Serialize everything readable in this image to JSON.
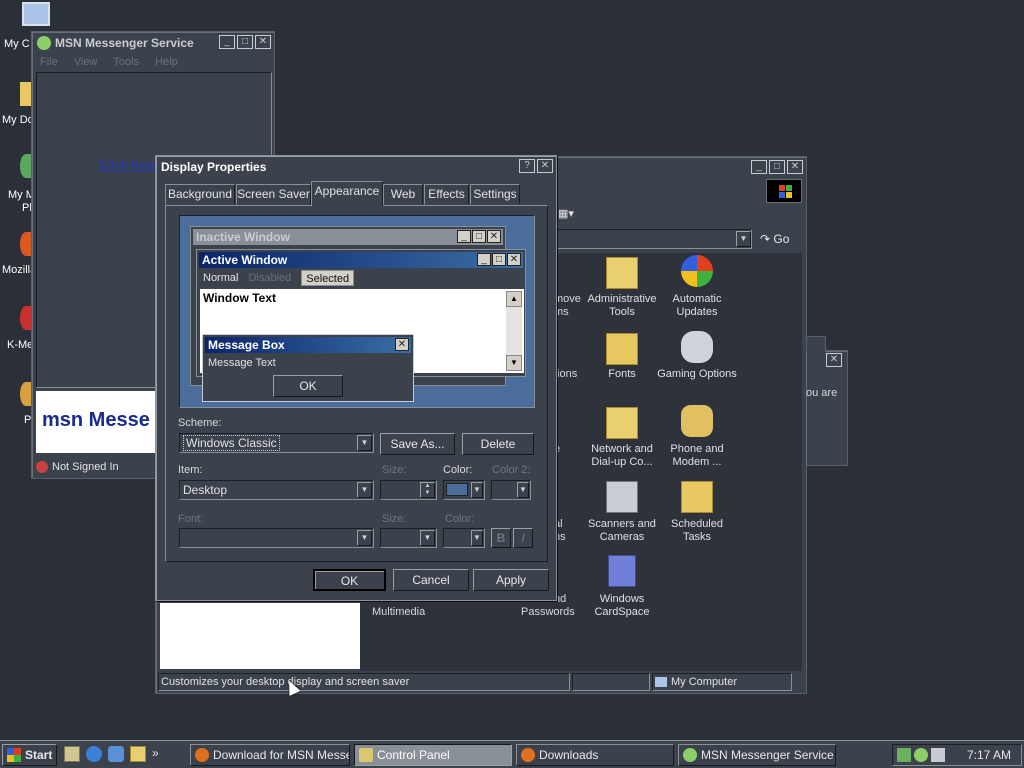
{
  "desktop": {
    "icons": [
      {
        "label": "My C"
      },
      {
        "label": "My Do"
      },
      {
        "label": "My M"
      },
      {
        "label": "Pl"
      },
      {
        "label": "Mozilla"
      },
      {
        "label": "K-Me"
      },
      {
        "label": "P"
      }
    ]
  },
  "msn": {
    "title": "MSN Messenger Service",
    "menu": [
      "File",
      "View",
      "Tools",
      "Help"
    ],
    "link": "Click here",
    "banner": "msn Messe",
    "status": "Not Signed In"
  },
  "control_panel": {
    "go_label": "Go",
    "items": [
      {
        "label": "Administrative Tools"
      },
      {
        "label": "Automatic Updates"
      },
      {
        "label": "Fonts"
      },
      {
        "label": "Gaming Options"
      },
      {
        "label": "Network and Dial-up Co..."
      },
      {
        "label": "Phone and Modem ..."
      },
      {
        "label": "Scanners and Cameras"
      },
      {
        "label": "Scheduled Tasks"
      },
      {
        "label": "Windows CardSpace"
      }
    ],
    "partial_labels": [
      "move",
      "ms",
      "tions",
      "e",
      "al",
      "ns",
      "nd",
      "Passwords",
      "Multimedia"
    ],
    "status_text": "Customizes your desktop display and screen saver",
    "status_zone": "My Computer"
  },
  "back_dialog": {
    "text": "ou are"
  },
  "display_properties": {
    "title": "Display Properties",
    "tabs": [
      "Background",
      "Screen Saver",
      "Appearance",
      "Web",
      "Effects",
      "Settings"
    ],
    "preview": {
      "inactive": "Inactive Window",
      "active": "Active Window",
      "menu_normal": "Normal",
      "menu_disabled": "Disabled",
      "menu_selected": "Selected",
      "window_text": "Window Text",
      "message_box": "Message Box",
      "message_text": "Message Text",
      "ok": "OK"
    },
    "scheme_label": "Scheme:",
    "scheme_value": "Windows Classic",
    "save_as": "Save As...",
    "delete": "Delete",
    "item_label": "Item:",
    "item_value": "Desktop",
    "size_label": "Size:",
    "color_label": "Color:",
    "color2_label": "Color 2:",
    "font_label": "Font:",
    "font_size_label": "Size:",
    "font_color_label": "Color:",
    "bold": "B",
    "italic": "I",
    "ok": "OK",
    "cancel": "Cancel",
    "apply": "Apply",
    "desktop_color": "#4a6d9c"
  },
  "taskbar": {
    "start": "Start",
    "tasks": [
      {
        "label": "Download for MSN Messe..."
      },
      {
        "label": "Control Panel"
      },
      {
        "label": "Downloads"
      },
      {
        "label": "MSN Messenger Service"
      }
    ],
    "clock": "7:17 AM"
  }
}
